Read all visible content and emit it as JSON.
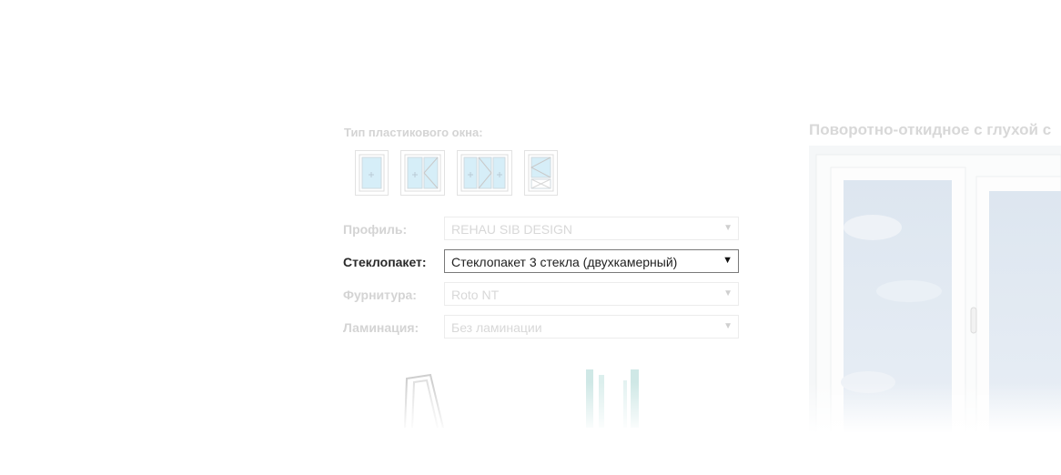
{
  "window_type": {
    "heading": "Тип пластикового окна:",
    "options": [
      {
        "name": "single-sash-icon"
      },
      {
        "name": "double-sash-icon"
      },
      {
        "name": "triple-sash-icon"
      },
      {
        "name": "balcony-door-icon"
      }
    ]
  },
  "form": {
    "profile": {
      "label": "Профиль:",
      "value": "REHAU SIB DESIGN"
    },
    "glazing": {
      "label": "Стеклопакет:",
      "value": "Стеклопакет 3 стекла (двухкамерный)"
    },
    "fittings": {
      "label": "Фурнитура:",
      "value": "Roto NT"
    },
    "lamination": {
      "label": "Ламинация:",
      "value": "Без ламинации"
    }
  },
  "preview": {
    "title": "Поворотно-откидное с глухой с"
  },
  "colors": {
    "active_label": "#2a2a2a",
    "inactive_label": "#d4d4d4",
    "glass": "#d6eef8",
    "sky": "#dde6f0"
  }
}
